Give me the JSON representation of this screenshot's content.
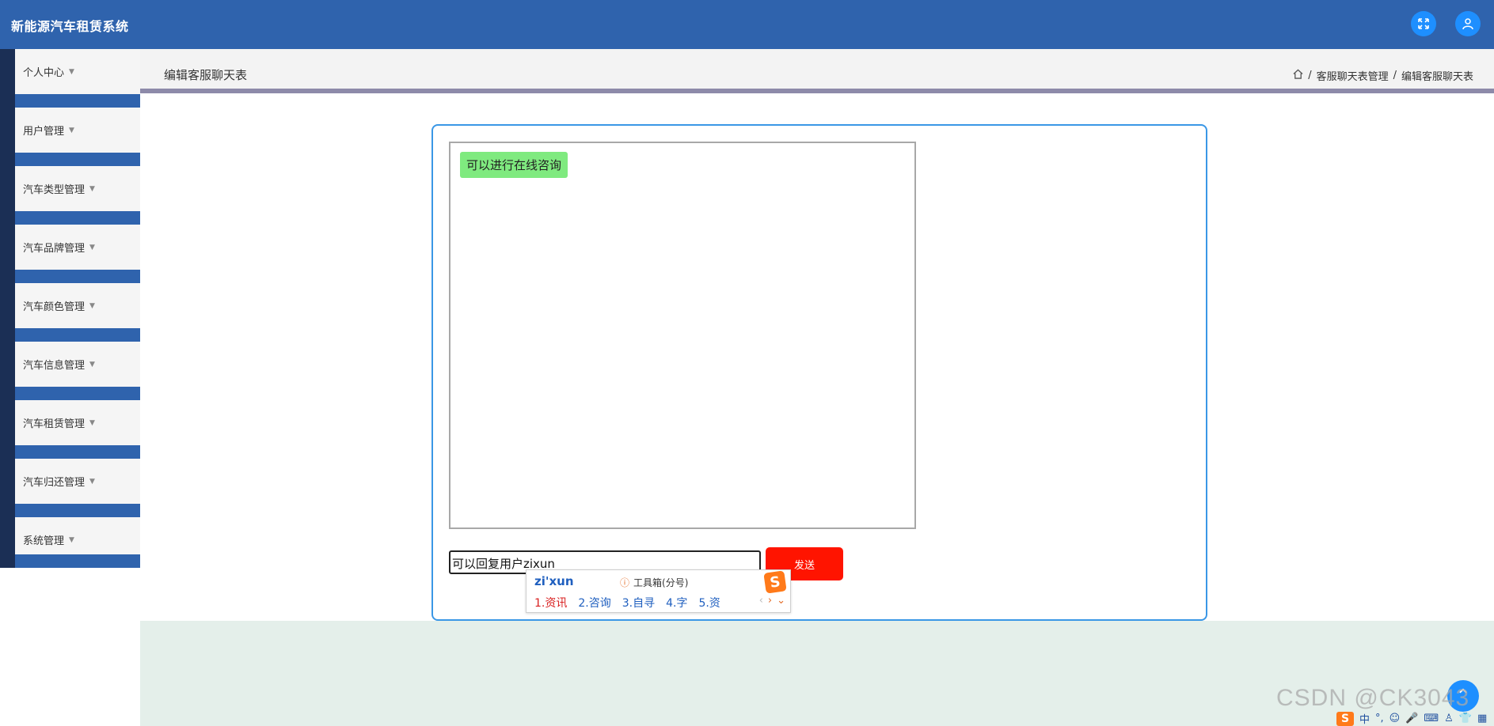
{
  "header": {
    "title": "新能源汽车租赁系统",
    "fullscreen_icon": "expand-icon",
    "user_icon": "user-icon"
  },
  "sidebar": {
    "items": [
      {
        "label": "个人中心"
      },
      {
        "label": "用户管理"
      },
      {
        "label": "汽车类型管理"
      },
      {
        "label": "汽车品牌管理"
      },
      {
        "label": "汽车颜色管理"
      },
      {
        "label": "汽车信息管理"
      },
      {
        "label": "汽车租赁管理"
      },
      {
        "label": "汽车归还管理"
      },
      {
        "label": "系统管理"
      }
    ]
  },
  "breadcrumb": {
    "page_title": "编辑客服聊天表",
    "sep1": "/",
    "level1": "客服聊天表管理",
    "sep2": "/",
    "level2": "编辑客服聊天表"
  },
  "chat": {
    "messages": [
      {
        "text": "可以进行在线咨询"
      }
    ],
    "input_value": "可以回复用户zixun",
    "send_label": "发送"
  },
  "ime": {
    "pinyin": "zi'xun",
    "tools_label": "工具箱(分号)",
    "candidates": [
      "1.资讯",
      "2.咨询",
      "3.自寻",
      "4.字",
      "5.资"
    ],
    "prev": "‹",
    "next": "›",
    "expand": "⌄",
    "logo": "S"
  },
  "watermark": "CSDN @CK3043",
  "float_button": "⌃",
  "tray": {
    "logo": "S",
    "lang": "中",
    "punct": "°,"
  },
  "colors": {
    "header": "#2f63ad",
    "accent": "#1e8fff",
    "send": "#ff1400",
    "message_bubble": "#7fea7f",
    "card_border": "#3a97e6"
  }
}
